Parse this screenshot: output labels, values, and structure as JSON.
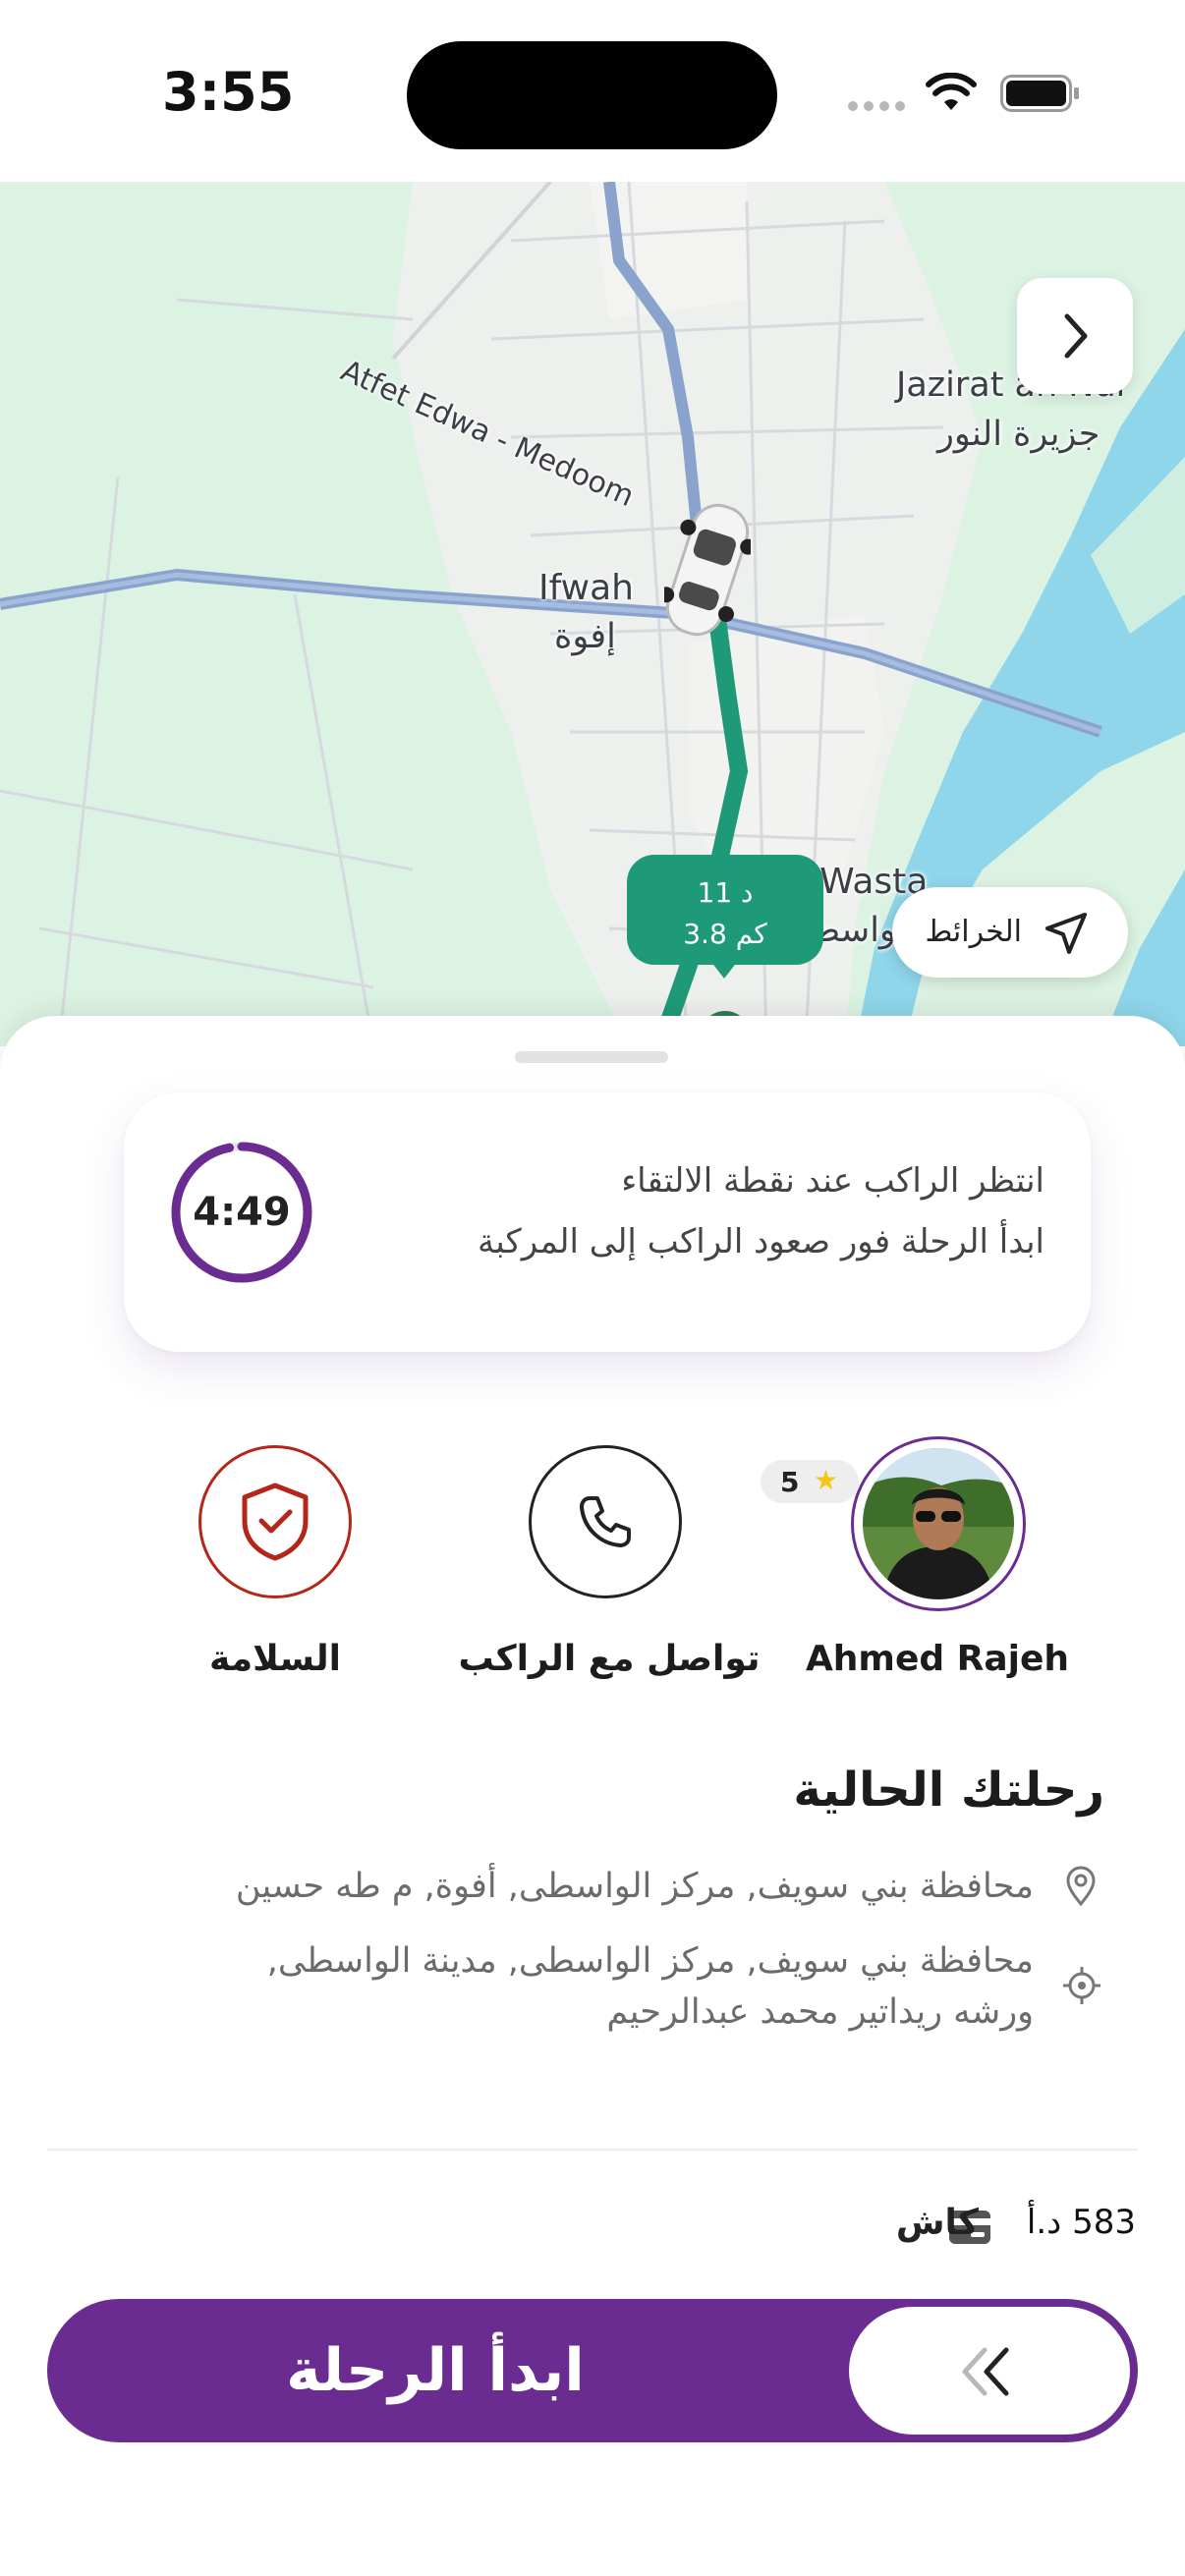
{
  "status_bar": {
    "time": "3:55"
  },
  "map": {
    "labels": {
      "road": "Atfet Edwa - Medoom",
      "jazirat_en": "Jazirat an Nur",
      "jazirat_ar": "جزيرة النور",
      "ifwah_en": "Ifwah",
      "ifwah_ar": "إفوة",
      "wasta_en": "Al Wasta",
      "wasta_ar": "الواسطى"
    },
    "eta": {
      "minutes": "11 د",
      "distance": "3.8 كم"
    },
    "maps_button_label": "الخرائط",
    "colors": {
      "route": "#1e9a79",
      "water": "#8fd6ea",
      "land": "#dcf3e3",
      "road": "#8aa3cc"
    }
  },
  "wait_card": {
    "title": "انتظر الراكب عند نقطة الالتقاء",
    "subtitle": "ابدأ الرحلة فور صعود الراكب إلى المركبة",
    "timer": "4:49",
    "timer_progress": 0.97
  },
  "actions": {
    "safety_label": "السلامة",
    "contact_label": "تواصل مع الراكب",
    "rider_name": "Ahmed Rajeh",
    "rider_rating": "5"
  },
  "trip": {
    "title": "رحلتك الحالية",
    "pickup": "محافظة بني سويف, مركز الواسطى, أفوة, م طه حسين",
    "dropoff_line1": "محافظة بني سويف, مركز الواسطى, مدينة الواسطى,",
    "dropoff_line2": "ورشه ريداتير محمد عبدالرحيم"
  },
  "payment": {
    "amount": "583 د.أ",
    "method": "كاش"
  },
  "start_button": {
    "label": "ابدأ الرحلة"
  },
  "colors": {
    "brand": "#6a2c91",
    "safety": "#b4261a",
    "route": "#1e9a79"
  }
}
